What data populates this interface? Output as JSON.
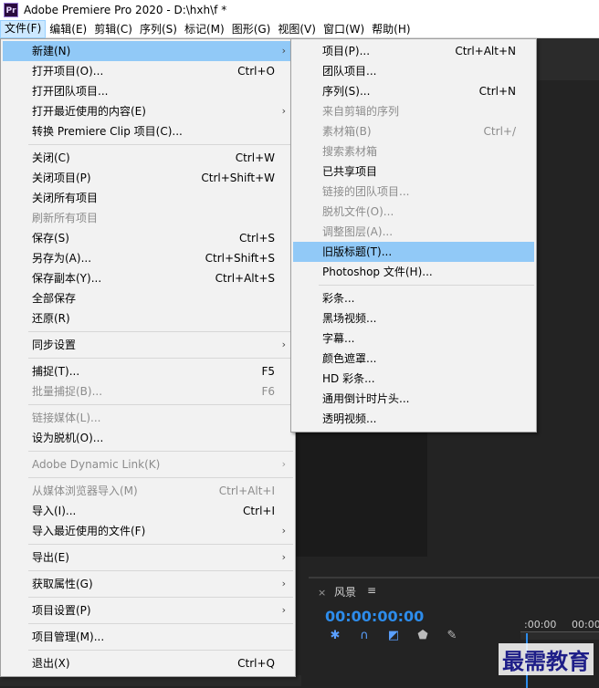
{
  "window": {
    "title": "Adobe Premiere Pro 2020 - D:\\hxh\\f *",
    "logo_text": "Pr"
  },
  "menubar": [
    {
      "label": "文件(F)",
      "active": true
    },
    {
      "label": "编辑(E)"
    },
    {
      "label": "剪辑(C)"
    },
    {
      "label": "序列(S)"
    },
    {
      "label": "标记(M)"
    },
    {
      "label": "图形(G)"
    },
    {
      "label": "视图(V)"
    },
    {
      "label": "窗口(W)"
    },
    {
      "label": "帮助(H)"
    }
  ],
  "file_menu": [
    {
      "label": "新建(N)",
      "shortcut": "",
      "submenu": true,
      "highlighted": true
    },
    {
      "label": "打开项目(O)...",
      "shortcut": "Ctrl+O"
    },
    {
      "label": "打开团队项目..."
    },
    {
      "label": "打开最近使用的内容(E)",
      "submenu": true
    },
    {
      "label": "转换 Premiere Clip 项目(C)..."
    },
    {
      "separator": true
    },
    {
      "label": "关闭(C)",
      "shortcut": "Ctrl+W"
    },
    {
      "label": "关闭项目(P)",
      "shortcut": "Ctrl+Shift+W"
    },
    {
      "label": "关闭所有项目"
    },
    {
      "label": "刷新所有项目",
      "disabled": true
    },
    {
      "label": "保存(S)",
      "shortcut": "Ctrl+S"
    },
    {
      "label": "另存为(A)...",
      "shortcut": "Ctrl+Shift+S"
    },
    {
      "label": "保存副本(Y)...",
      "shortcut": "Ctrl+Alt+S"
    },
    {
      "label": "全部保存"
    },
    {
      "label": "还原(R)"
    },
    {
      "separator": true
    },
    {
      "label": "同步设置",
      "submenu": true
    },
    {
      "separator": true
    },
    {
      "label": "捕捉(T)...",
      "shortcut": "F5"
    },
    {
      "label": "批量捕捉(B)...",
      "shortcut": "F6",
      "disabled": true
    },
    {
      "separator": true
    },
    {
      "label": "链接媒体(L)...",
      "disabled": true
    },
    {
      "label": "设为脱机(O)..."
    },
    {
      "separator": true
    },
    {
      "label": "Adobe Dynamic Link(K)",
      "submenu": true,
      "disabled": true
    },
    {
      "separator": true
    },
    {
      "label": "从媒体浏览器导入(M)",
      "shortcut": "Ctrl+Alt+I",
      "disabled": true
    },
    {
      "label": "导入(I)...",
      "shortcut": "Ctrl+I"
    },
    {
      "label": "导入最近使用的文件(F)",
      "submenu": true
    },
    {
      "separator": true
    },
    {
      "label": "导出(E)",
      "submenu": true
    },
    {
      "separator": true
    },
    {
      "label": "获取属性(G)",
      "submenu": true
    },
    {
      "separator": true
    },
    {
      "label": "项目设置(P)",
      "submenu": true
    },
    {
      "separator": true
    },
    {
      "label": "项目管理(M)..."
    },
    {
      "separator": true
    },
    {
      "label": "退出(X)",
      "shortcut": "Ctrl+Q"
    }
  ],
  "new_submenu": [
    {
      "label": "项目(P)...",
      "shortcut": "Ctrl+Alt+N"
    },
    {
      "label": "团队项目..."
    },
    {
      "label": "序列(S)...",
      "shortcut": "Ctrl+N"
    },
    {
      "label": "来自剪辑的序列",
      "disabled": true
    },
    {
      "label": "素材箱(B)",
      "shortcut": "Ctrl+/",
      "disabled": true
    },
    {
      "label": "搜索素材箱",
      "disabled": true
    },
    {
      "label": "已共享项目"
    },
    {
      "label": "链接的团队项目...",
      "disabled": true
    },
    {
      "label": "脱机文件(O)...",
      "disabled": true
    },
    {
      "label": "调整图层(A)...",
      "disabled": true
    },
    {
      "label": "旧版标题(T)...",
      "highlighted": true
    },
    {
      "label": "Photoshop 文件(H)..."
    },
    {
      "separator": true
    },
    {
      "label": "彩条..."
    },
    {
      "label": "黑场视频..."
    },
    {
      "label": "字幕..."
    },
    {
      "label": "颜色遮罩..."
    },
    {
      "label": "HD 彩条..."
    },
    {
      "label": "通用倒计时片头..."
    },
    {
      "label": "透明视频..."
    }
  ],
  "timeline": {
    "close": "×",
    "name": "风景",
    "menu": "≡",
    "timecode": "00:00:00:00",
    "ruler_left": ":00:00",
    "ruler_right": "00:00"
  },
  "watermark": "最需教育"
}
